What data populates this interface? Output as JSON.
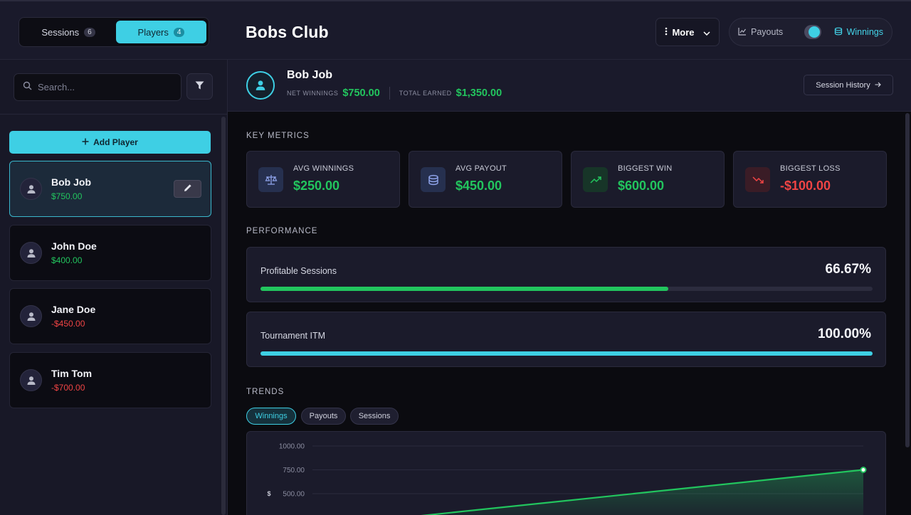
{
  "header": {
    "tabs": [
      {
        "label": "Sessions",
        "count": "6"
      },
      {
        "label": "Players",
        "count": "4"
      }
    ],
    "title": "Bobs Club",
    "more_label": "More",
    "toggle": {
      "left_label": "Payouts",
      "right_label": "Winnings"
    }
  },
  "sidebar": {
    "search_placeholder": "Search...",
    "add_label": "Add Player",
    "players": [
      {
        "name": "Bob Job",
        "amount": "$750.00"
      },
      {
        "name": "John Doe",
        "amount": "$400.00"
      },
      {
        "name": "Jane Doe",
        "amount": "-$450.00"
      },
      {
        "name": "Tim Tom",
        "amount": "-$700.00"
      }
    ]
  },
  "player": {
    "name": "Bob Job",
    "net_label": "NET WINNINGS",
    "net_value": "$750.00",
    "total_label": "TOTAL EARNED",
    "total_value": "$1,350.00",
    "history_label": "Session History"
  },
  "metrics": {
    "title": "KEY METRICS",
    "items": [
      {
        "label": "AVG WINNINGS",
        "value": "$250.00",
        "icon": "scale-icon"
      },
      {
        "label": "AVG PAYOUT",
        "value": "$450.00",
        "icon": "coins-icon"
      },
      {
        "label": "BIGGEST WIN",
        "value": "$600.00",
        "icon": "trending-up-icon"
      },
      {
        "label": "BIGGEST LOSS",
        "value": "-$100.00",
        "icon": "trending-down-icon"
      }
    ]
  },
  "performance": {
    "title": "PERFORMANCE",
    "items": [
      {
        "label": "Profitable Sessions",
        "value": "66.67%",
        "fraction": 0.6667,
        "color": "#22c55e"
      },
      {
        "label": "Tournament ITM",
        "value": "100.00%",
        "fraction": 1.0,
        "color": "#3ecfe4"
      }
    ]
  },
  "trends": {
    "title": "TRENDS",
    "tabs": [
      "Winnings",
      "Payouts",
      "Sessions"
    ]
  },
  "colors": {
    "accent": "#3ecfe4",
    "positive": "#22c55e",
    "negative": "#ef4444"
  },
  "chart_data": {
    "type": "area",
    "ylabel": "$",
    "yticks": [
      "1000.00",
      "750.00",
      "500.00"
    ],
    "ylim": [
      0,
      1000
    ],
    "points": [
      {
        "x": 0,
        "y": 150
      },
      {
        "x": 1,
        "y": 750
      }
    ]
  }
}
